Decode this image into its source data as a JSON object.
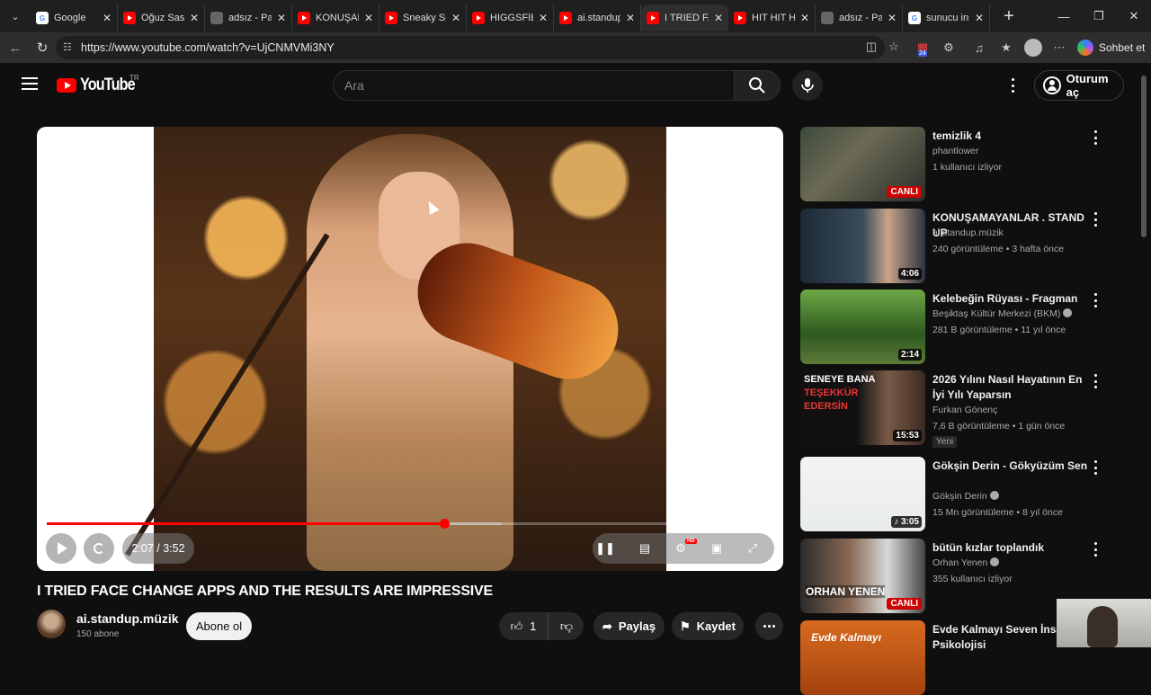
{
  "browser": {
    "tabs": [
      {
        "title": "Google",
        "icon": "google-icon"
      },
      {
        "title": "Oğuz Sasi v",
        "icon": "youtube-icon"
      },
      {
        "title": "adsız - Pain",
        "icon": "paint-icon"
      },
      {
        "title": "KONUŞAM",
        "icon": "youtube-icon"
      },
      {
        "title": "Sneaky Sni",
        "icon": "youtube-icon"
      },
      {
        "title": "HIGGSFİEL",
        "icon": "youtube-icon"
      },
      {
        "title": "ai.standup.",
        "icon": "youtube-icon"
      },
      {
        "title": "I TRIED FAC",
        "icon": "youtube-icon",
        "active": true
      },
      {
        "title": "HIT HIT HI",
        "icon": "youtube-icon"
      },
      {
        "title": "adsız - Pain",
        "icon": "paint-icon"
      },
      {
        "title": "sunucu ins",
        "icon": "google-icon"
      }
    ],
    "url": "https://www.youtube.com/watch?v=UjCNMVMi3NY",
    "copilot_label": "Sohbet et",
    "badge_count": "24"
  },
  "youtube": {
    "logo_text": "YouTube",
    "country_code": "TR",
    "search_placeholder": "Ara",
    "signin_label": "Oturum aç"
  },
  "player": {
    "time": "2:07 / 3:52",
    "progress": 0.546,
    "buffered": 0.625
  },
  "video": {
    "title": "I TRIED FACE CHANGE APPS AND THE RESULTS ARE IMPRESSIVE",
    "channel": "ai.standup.müzik",
    "subscribers": "150 abone",
    "subscribe_label": "Abone ol",
    "likes": "1",
    "share_label": "Paylaş",
    "save_label": "Kaydet"
  },
  "recommendations": [
    {
      "title": "temizlik 4",
      "channel": "phantlower",
      "meta": "1 kullanıcı izliyor",
      "badge_text": "CANLI",
      "badge_type": "live"
    },
    {
      "title": "KONUŞAMAYANLAR . STAND UP",
      "channel": "ai.standup.müzik",
      "meta": "240 görüntüleme • 3 hafta önce",
      "badge_text": "4:06",
      "badge_type": "duration"
    },
    {
      "title": "Kelebeğin Rüyası - Fragman",
      "channel": "Beşiktaş Kültür Merkezi (BKM)",
      "meta": "281 B görüntüleme • 11 yıl önce",
      "badge_text": "2:14",
      "badge_type": "duration",
      "verified": true
    },
    {
      "title": "2026 Yılını Nasıl Hayatının En İyi Yılı Yaparsın",
      "channel": "Furkan Gönenç",
      "meta": "7,6 B görüntüleme • 1 gün önce",
      "badge_text": "15:53",
      "badge_type": "duration",
      "extra": "Yeni",
      "thumb_lines": [
        "SENEYE BANA",
        "TEŞEKKÜR",
        "EDERSİN"
      ]
    },
    {
      "title": "Gökşin Derin - Gökyüzüm Sen",
      "channel": "Gökşin Derin",
      "meta": "15 Mn görüntüleme • 8 yıl önce",
      "badge_text": "♪ 3:05",
      "badge_type": "duration",
      "verified": true
    },
    {
      "title": "bütün kızlar toplandık",
      "channel": "Orhan Yenen",
      "meta": "355 kullanıcı izliyor",
      "badge_text": "CANLI",
      "badge_type": "live",
      "verified": true,
      "thumb_lines": [
        "ORHAN YENEN"
      ]
    },
    {
      "title": "Evde Kalmayı Seven İnsanlar Psikolojisi",
      "thumb_lines": [
        "Evde Kalmayı"
      ]
    }
  ]
}
